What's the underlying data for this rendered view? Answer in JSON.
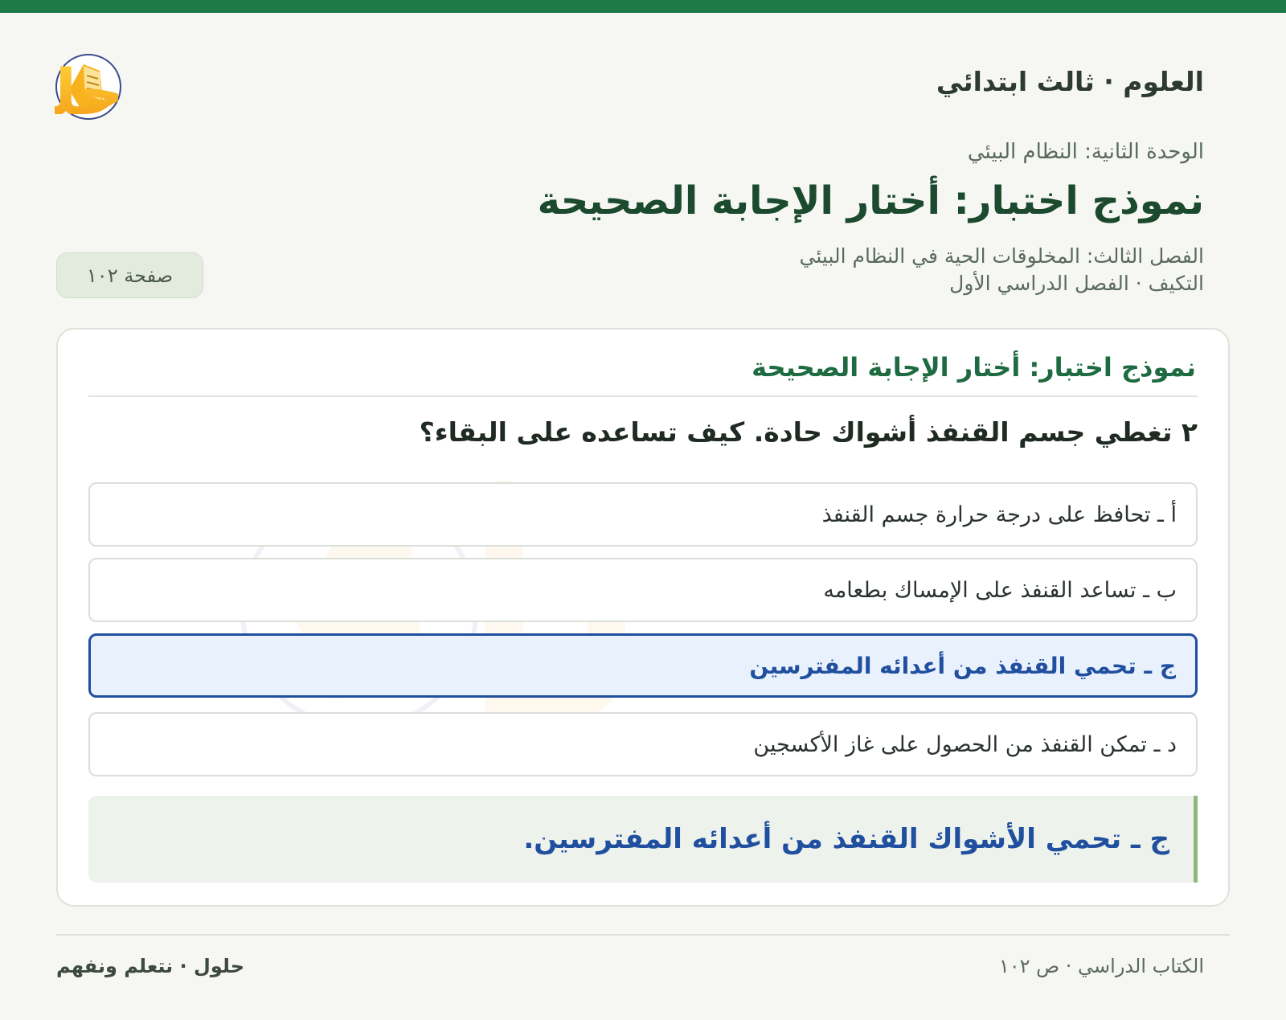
{
  "header": {
    "subject": "العلوم · ثالث ابتدائي",
    "logo_text": "حلول"
  },
  "meta": {
    "unit": "الوحدة الثانية: النظام البيئي",
    "main_title": "نموذج اختبار: أختار الإجابة الصحيحة",
    "chapter": "الفصل الثالث: المخلوقات الحية في النظام البيئي",
    "lesson": "التكيف · الفصل الدراسي الأول",
    "page_badge": "صفحة ١٠٢"
  },
  "card": {
    "title": "نموذج اختبار: أختار الإجابة الصحيحة",
    "question": "٢ تغطي جسم القنفذ أشواك حادة. كيف تساعده على البقاء؟",
    "options": [
      {
        "label": "أ ـ تحافظ على درجة حرارة جسم القنفذ",
        "selected": false
      },
      {
        "label": "ب ـ تساعد القنفذ على الإمساك بطعامه",
        "selected": false
      },
      {
        "label": "ج ـ تحمي القنفذ من أعدائه المفترسين",
        "selected": true
      },
      {
        "label": "د ـ تمكن القنفذ من الحصول على غاز الأكسجين",
        "selected": false
      }
    ],
    "answer": "ج ـ تحمي الأشواك القنفذ من أعدائه المفترسين."
  },
  "footer": {
    "right": "الكتاب الدراسي · ص ١٠٢",
    "left": "حلول · نتعلم ونفهم"
  },
  "colors": {
    "brand_green": "#1f7a4a",
    "selected_blue": "#1f4f9e",
    "logo_orange": "#f4a21c"
  }
}
